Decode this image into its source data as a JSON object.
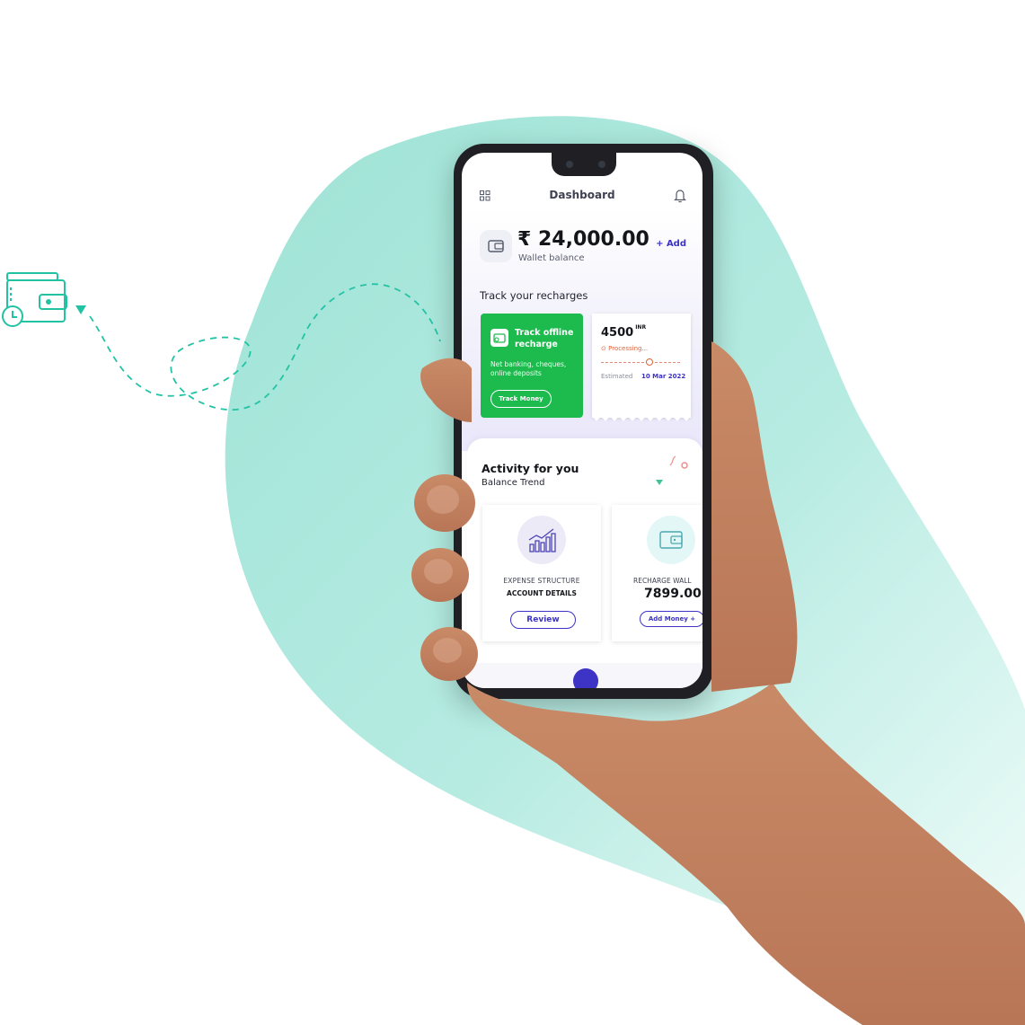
{
  "dashboard": {
    "title": "Dashboard",
    "balance": "₹ 24,000.00",
    "balance_label": "Wallet balance",
    "add_label": "+ Add"
  },
  "recharges": {
    "heading": "Track your recharges",
    "offline": {
      "title": "Track offline recharge",
      "description": "Net banking, cheques, online deposits",
      "button": "Track Money"
    },
    "pending": {
      "amount": "4500",
      "currency": "INR",
      "status": "Processing...",
      "estimated_label": "Estimated",
      "estimated_date": "10 Mar 2022"
    }
  },
  "activity": {
    "heading": "Activity for you",
    "subheading": "Balance Trend",
    "cards": [
      {
        "label": "EXPENSE STRUCTURE",
        "title": "ACCOUNT DETAILS",
        "button": "Review"
      },
      {
        "label": "RECHARGE WALL",
        "value": "7899.00",
        "button": "Add Money +"
      }
    ]
  },
  "colors": {
    "teal_blob": "#a8e6dc",
    "accent": "#3d33c4",
    "green": "#1dbb4e",
    "processing": "#e0623a"
  },
  "icons": [
    "wallet-icon",
    "grid-icon",
    "bell-icon",
    "chart-icon",
    "clock-icon"
  ]
}
